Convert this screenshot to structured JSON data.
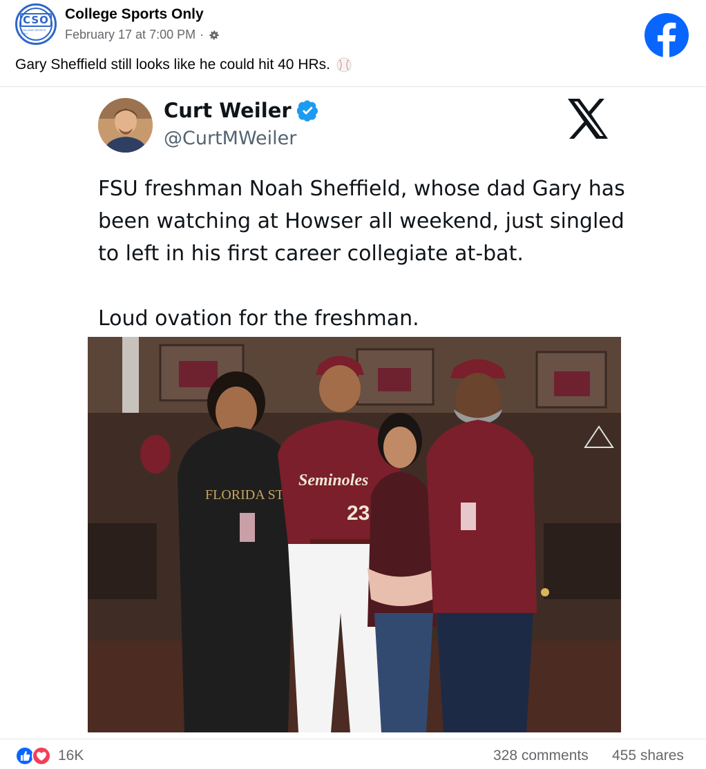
{
  "post": {
    "page_name": "College Sports Only",
    "avatar_text": "CSO",
    "avatar_subtext": "COLLEGE SPORTS ONLY",
    "timestamp": "February 17 at 7:00 PM",
    "separator": "·",
    "caption": "Gary Sheffield still looks like he could hit 40 HRs."
  },
  "tweet": {
    "author_name": "Curt Weiler",
    "handle": "@CurtMWeiler",
    "paragraph_1": "FSU freshman Noah Sheffield, whose dad Gary has been watching at Howser all weekend, just singled to left in his first career collegiate at-bat.",
    "paragraph_2": "Loud ovation for the freshman.",
    "photo_jersey_text": "Seminoles",
    "photo_jersey_number": "23",
    "photo_hoodie_text": "FLORIDA STATE"
  },
  "engagement": {
    "reaction_count": "16K",
    "comments": "328 comments",
    "shares": "455 shares"
  },
  "colors": {
    "facebook_blue": "#0866ff",
    "x_black": "#0f1419",
    "verified_blue": "#1d9bf0",
    "garnet": "#7a1f2b",
    "secondary_text": "#65676b"
  },
  "icons": [
    "gear-icon",
    "facebook-logo-icon",
    "baseball-icon",
    "verified-badge-icon",
    "x-logo-icon",
    "like-reaction-icon",
    "love-reaction-icon"
  ]
}
